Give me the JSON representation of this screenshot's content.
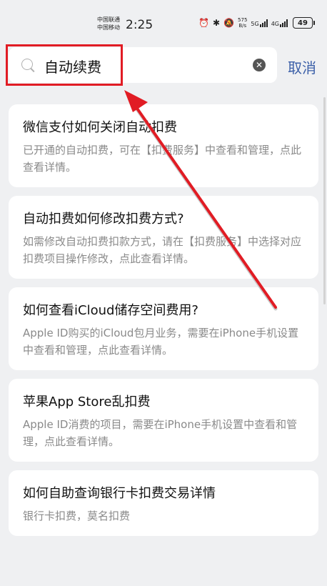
{
  "status_bar": {
    "carrier_1": "中国联通",
    "carrier_2": "中国移动",
    "time": "2:25",
    "net_speed": "575",
    "net_speed_unit": "B/s",
    "net_type_1": "5G",
    "net_type_2": "4G",
    "battery": "49"
  },
  "search": {
    "value": "自动续费",
    "cancel_label": "取消"
  },
  "results": [
    {
      "title": "微信支付如何关闭自动扣费",
      "desc": "已开通的自动扣费，可在【扣费服务】中查看和管理，点此查看详情。"
    },
    {
      "title": "自动扣费如何修改扣费方式?",
      "desc": "如需修改自动扣费扣款方式，请在【扣费服务】中选择对应扣费项目操作修改，点此查看详情。"
    },
    {
      "title": "如何查看iCloud储存空间费用?",
      "desc": "Apple ID购买的iCloud包月业务，需要在iPhone手机设置中查看和管理，点此查看详情。"
    },
    {
      "title": "苹果App Store乱扣费",
      "desc": "Apple ID消费的项目，需要在iPhone手机设置中查看和管理，点此查看详情。"
    },
    {
      "title": "如何自助查询银行卡扣费交易详情",
      "desc": "银行卡扣费，莫名扣费"
    }
  ],
  "colors": {
    "highlight": "#e11c24",
    "accent": "#3b5fa8"
  }
}
